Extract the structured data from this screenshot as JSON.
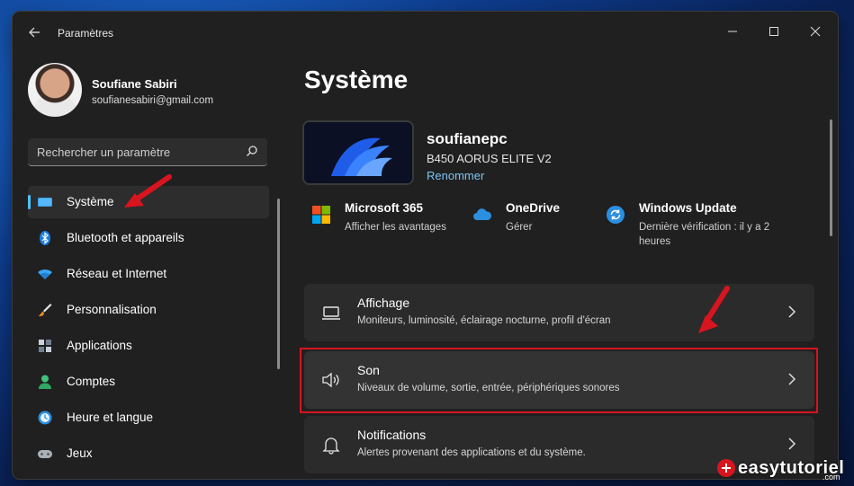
{
  "window": {
    "title": "Paramètres"
  },
  "profile": {
    "name": "Soufiane Sabiri",
    "email": "soufianesabiri@gmail.com"
  },
  "search": {
    "placeholder": "Rechercher un paramètre"
  },
  "nav": [
    {
      "label": "Système",
      "icon": "monitor-icon",
      "active": true
    },
    {
      "label": "Bluetooth et appareils",
      "icon": "bluetooth-icon"
    },
    {
      "label": "Réseau et Internet",
      "icon": "wifi-icon"
    },
    {
      "label": "Personnalisation",
      "icon": "brush-icon"
    },
    {
      "label": "Applications",
      "icon": "apps-icon"
    },
    {
      "label": "Comptes",
      "icon": "person-icon"
    },
    {
      "label": "Heure et langue",
      "icon": "clock-globe-icon"
    },
    {
      "label": "Jeux",
      "icon": "gamepad-icon"
    }
  ],
  "main": {
    "title": "Système",
    "pc": {
      "name": "soufianepc",
      "model": "B450 AORUS ELITE V2",
      "rename": "Renommer"
    },
    "quick": [
      {
        "title": "Microsoft 365",
        "sub": "Afficher les avantages",
        "icon": "microsoft-logo-icon"
      },
      {
        "title": "OneDrive",
        "sub": "Gérer",
        "icon": "cloud-icon"
      },
      {
        "title": "Windows Update",
        "sub": "Dernière vérification : il y a 2 heures",
        "icon": "update-icon"
      }
    ],
    "cards": [
      {
        "title": "Affichage",
        "sub": "Moniteurs, luminosité, éclairage nocturne, profil d'écran",
        "icon": "laptop-icon"
      },
      {
        "title": "Son",
        "sub": "Niveaux de volume, sortie, entrée, périphériques sonores",
        "icon": "speaker-icon"
      },
      {
        "title": "Notifications",
        "sub": "Alertes provenant des applications et du système.",
        "icon": "bell-icon"
      }
    ]
  },
  "watermark": {
    "text": "easytutoriel",
    "suffix": ".com"
  },
  "colors": {
    "accent": "#4cc2ff",
    "link": "#7cc4f3",
    "highlight": "#d8141f",
    "window_bg": "#202020",
    "card_bg": "#2b2b2b"
  }
}
